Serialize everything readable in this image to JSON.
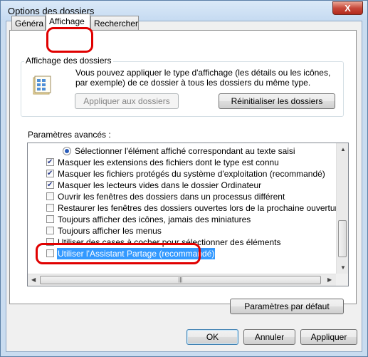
{
  "window": {
    "title": "Options des dossiers",
    "close_glyph": "X"
  },
  "tabs": [
    {
      "label": "Généra"
    },
    {
      "label": "Affichage"
    },
    {
      "label": "Rechercher"
    }
  ],
  "folder_view": {
    "group_label": "Affichage des dossiers",
    "description": "Vous pouvez appliquer le type d'affichage (les détails ou les icônes, par exemple) de ce dossier à tous les dossiers du même type.",
    "apply_button": "Appliquer aux dossiers",
    "reset_button": "Réinitialiser les dossiers",
    "icon": "folder-options-icon"
  },
  "advanced": {
    "label": "Paramètres avancés :",
    "items": [
      {
        "type": "radio",
        "checked": true,
        "label": "Sélectionner l'élément affiché correspondant au texte saisi"
      },
      {
        "type": "checkbox",
        "checked": true,
        "label": "Masquer les extensions des fichiers dont le type est connu"
      },
      {
        "type": "checkbox",
        "checked": true,
        "label": "Masquer les fichiers protégés du système d'exploitation (recommandé)"
      },
      {
        "type": "checkbox",
        "checked": true,
        "label": "Masquer les lecteurs vides dans le dossier Ordinateur"
      },
      {
        "type": "checkbox",
        "checked": false,
        "label": "Ouvrir les fenêtres des dossiers dans un processus différent"
      },
      {
        "type": "checkbox",
        "checked": false,
        "label": "Restaurer les fenêtres des dossiers ouvertes lors de la prochaine ouverture de se"
      },
      {
        "type": "checkbox",
        "checked": false,
        "label": "Toujours afficher des icônes, jamais des miniatures"
      },
      {
        "type": "checkbox",
        "checked": false,
        "label": "Toujours afficher les menus"
      },
      {
        "type": "checkbox",
        "checked": false,
        "label": "Utiliser des cases à cocher pour sélectionner des éléments"
      },
      {
        "type": "checkbox",
        "checked": false,
        "label": "Utiliser l'Assistant Partage (recommandé)"
      }
    ],
    "default_button": "Paramètres par défaut"
  },
  "footer": {
    "ok": "OK",
    "cancel": "Annuler",
    "apply": "Appliquer"
  },
  "colors": {
    "highlight": "#e00000",
    "selection": "#3399ff",
    "title_bar": "#c6dbf1"
  }
}
